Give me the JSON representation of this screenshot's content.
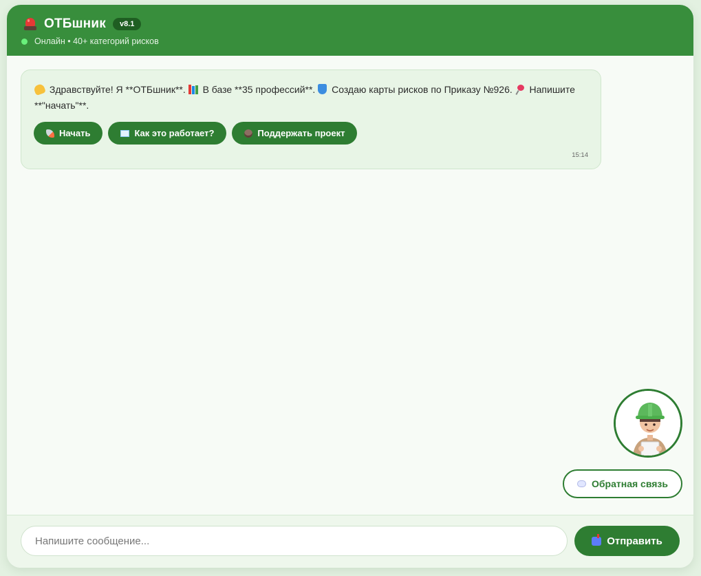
{
  "header": {
    "title": "ОТБшник",
    "version": "v8.1",
    "status": "Онлайн • 40+ категорий рисков"
  },
  "message": {
    "part1": "Здравствуйте! Я **ОТБшник**.",
    "part2": "В базе **35 профессий**.",
    "part3": "Создаю карты рисков по Приказу №926.",
    "part4": "Напишите **\"начать\"**.",
    "time": "15:14",
    "buttons": [
      {
        "label": "Начать",
        "icon": "rocket-icon"
      },
      {
        "label": "Как это работает?",
        "icon": "book-icon"
      },
      {
        "label": "Поддержать проект",
        "icon": "coffee-icon"
      }
    ]
  },
  "feedback": {
    "label": "Обратная связь",
    "icon": "speech-bubble-icon"
  },
  "composer": {
    "placeholder": "Напишите сообщение...",
    "send_label": "Отправить",
    "send_icon": "mailbox-icon"
  },
  "colors": {
    "primary": "#388e3c",
    "button": "#2e7d32",
    "bubble": "#e8f5e6",
    "background": "#e3f1e1",
    "online": "#69f07b"
  }
}
